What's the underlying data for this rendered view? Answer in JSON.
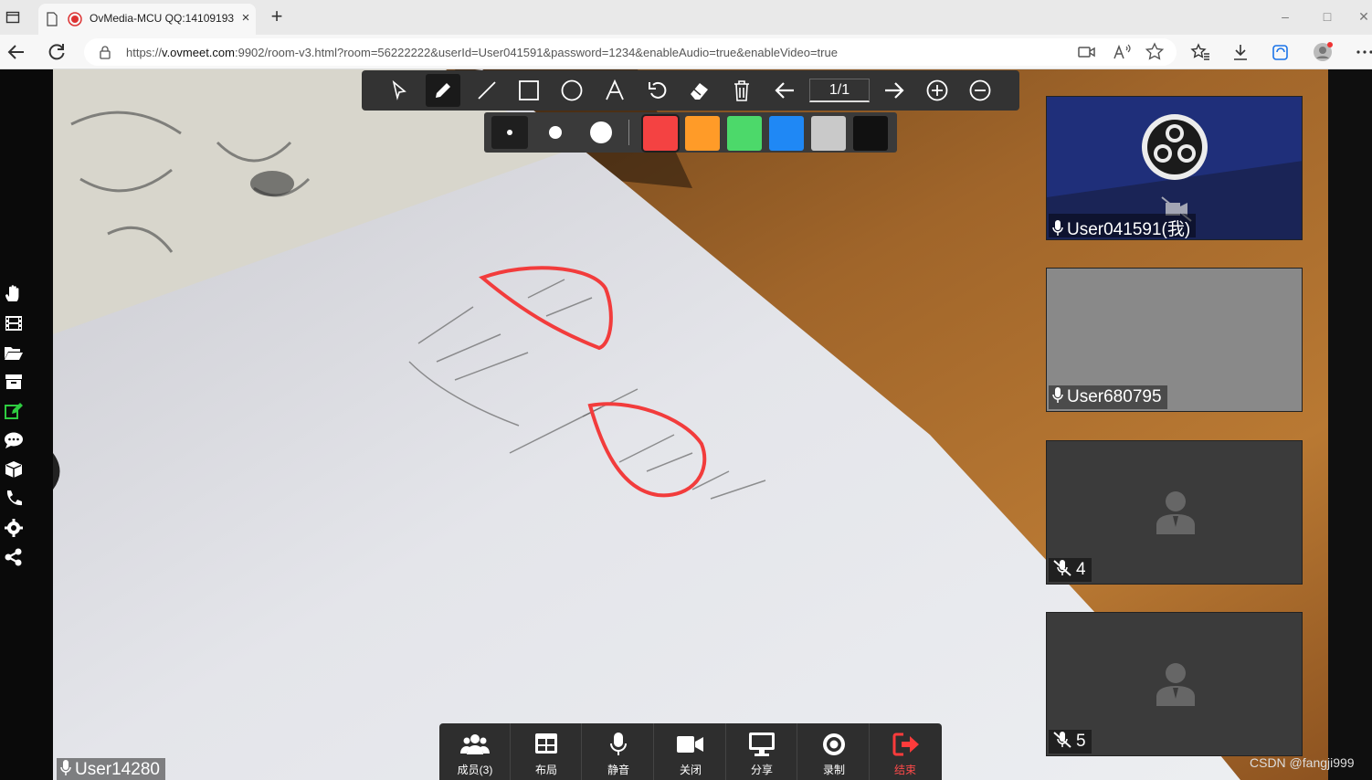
{
  "browser": {
    "tab_title": "OvMedia-MCU QQ:14109193",
    "tab_close": "×",
    "new_tab": "+",
    "url_prefix": "https://",
    "url_host": "v.ovmeet.com",
    "url_rest": ":9902/room-v3.html?room=56222222&userId=User041591&password=1234&enableAudio=true&enableVideo=true",
    "window_controls": [
      "–",
      "□",
      "✕"
    ]
  },
  "whiteboard": {
    "tools": [
      "select-icon",
      "pen-icon",
      "line-icon",
      "rectangle-icon",
      "circle-icon",
      "text-icon",
      "undo-icon",
      "eraser-icon",
      "trash-icon",
      "prev-page-icon",
      "next-page-icon",
      "zoom-in-icon",
      "zoom-out-icon"
    ],
    "active_tool": "pen",
    "page_indicator": "1/1",
    "pen_sizes": [
      "small",
      "medium",
      "large"
    ],
    "active_size": "small",
    "colors": [
      "#f44242",
      "#ff9b28",
      "#4cd96a",
      "#1f88f5",
      "#c9c9c9",
      "#111111"
    ],
    "active_color": "#f44242"
  },
  "main_video": {
    "user_label": "User14280"
  },
  "participants": [
    {
      "name": "User041591(我)",
      "mic": "on",
      "kind": "obs"
    },
    {
      "name": "User680795",
      "mic": "on",
      "kind": "gray"
    },
    {
      "name": "4",
      "mic": "muted",
      "kind": "avatar"
    },
    {
      "name": "5",
      "mic": "muted",
      "kind": "avatar"
    }
  ],
  "controls": {
    "members": "成员(3)",
    "layout": "布局",
    "mute": "静音",
    "camera_off": "关闭",
    "share": "分享",
    "record": "录制",
    "end": "结束"
  },
  "left_rail_icons": [
    "hand-icon",
    "film-icon",
    "folder-open-icon",
    "archive-icon",
    "edit-icon",
    "chat-icon",
    "cube-icon",
    "phone-icon",
    "settings-icon",
    "share-icon"
  ],
  "watermark": "CSDN @fangji999"
}
